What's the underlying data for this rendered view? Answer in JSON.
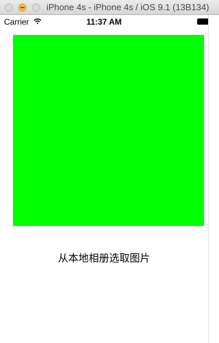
{
  "window": {
    "title": "iPhone 4s - iPhone 4s / iOS 9.1 (13B134)"
  },
  "status_bar": {
    "carrier": "Carrier",
    "time": "11:37 AM",
    "wifi_icon": "wifi-icon",
    "battery_icon": "battery-icon"
  },
  "main": {
    "image_view_color": "#00ff00",
    "pick_button_label": "从本地相册选取图片"
  }
}
